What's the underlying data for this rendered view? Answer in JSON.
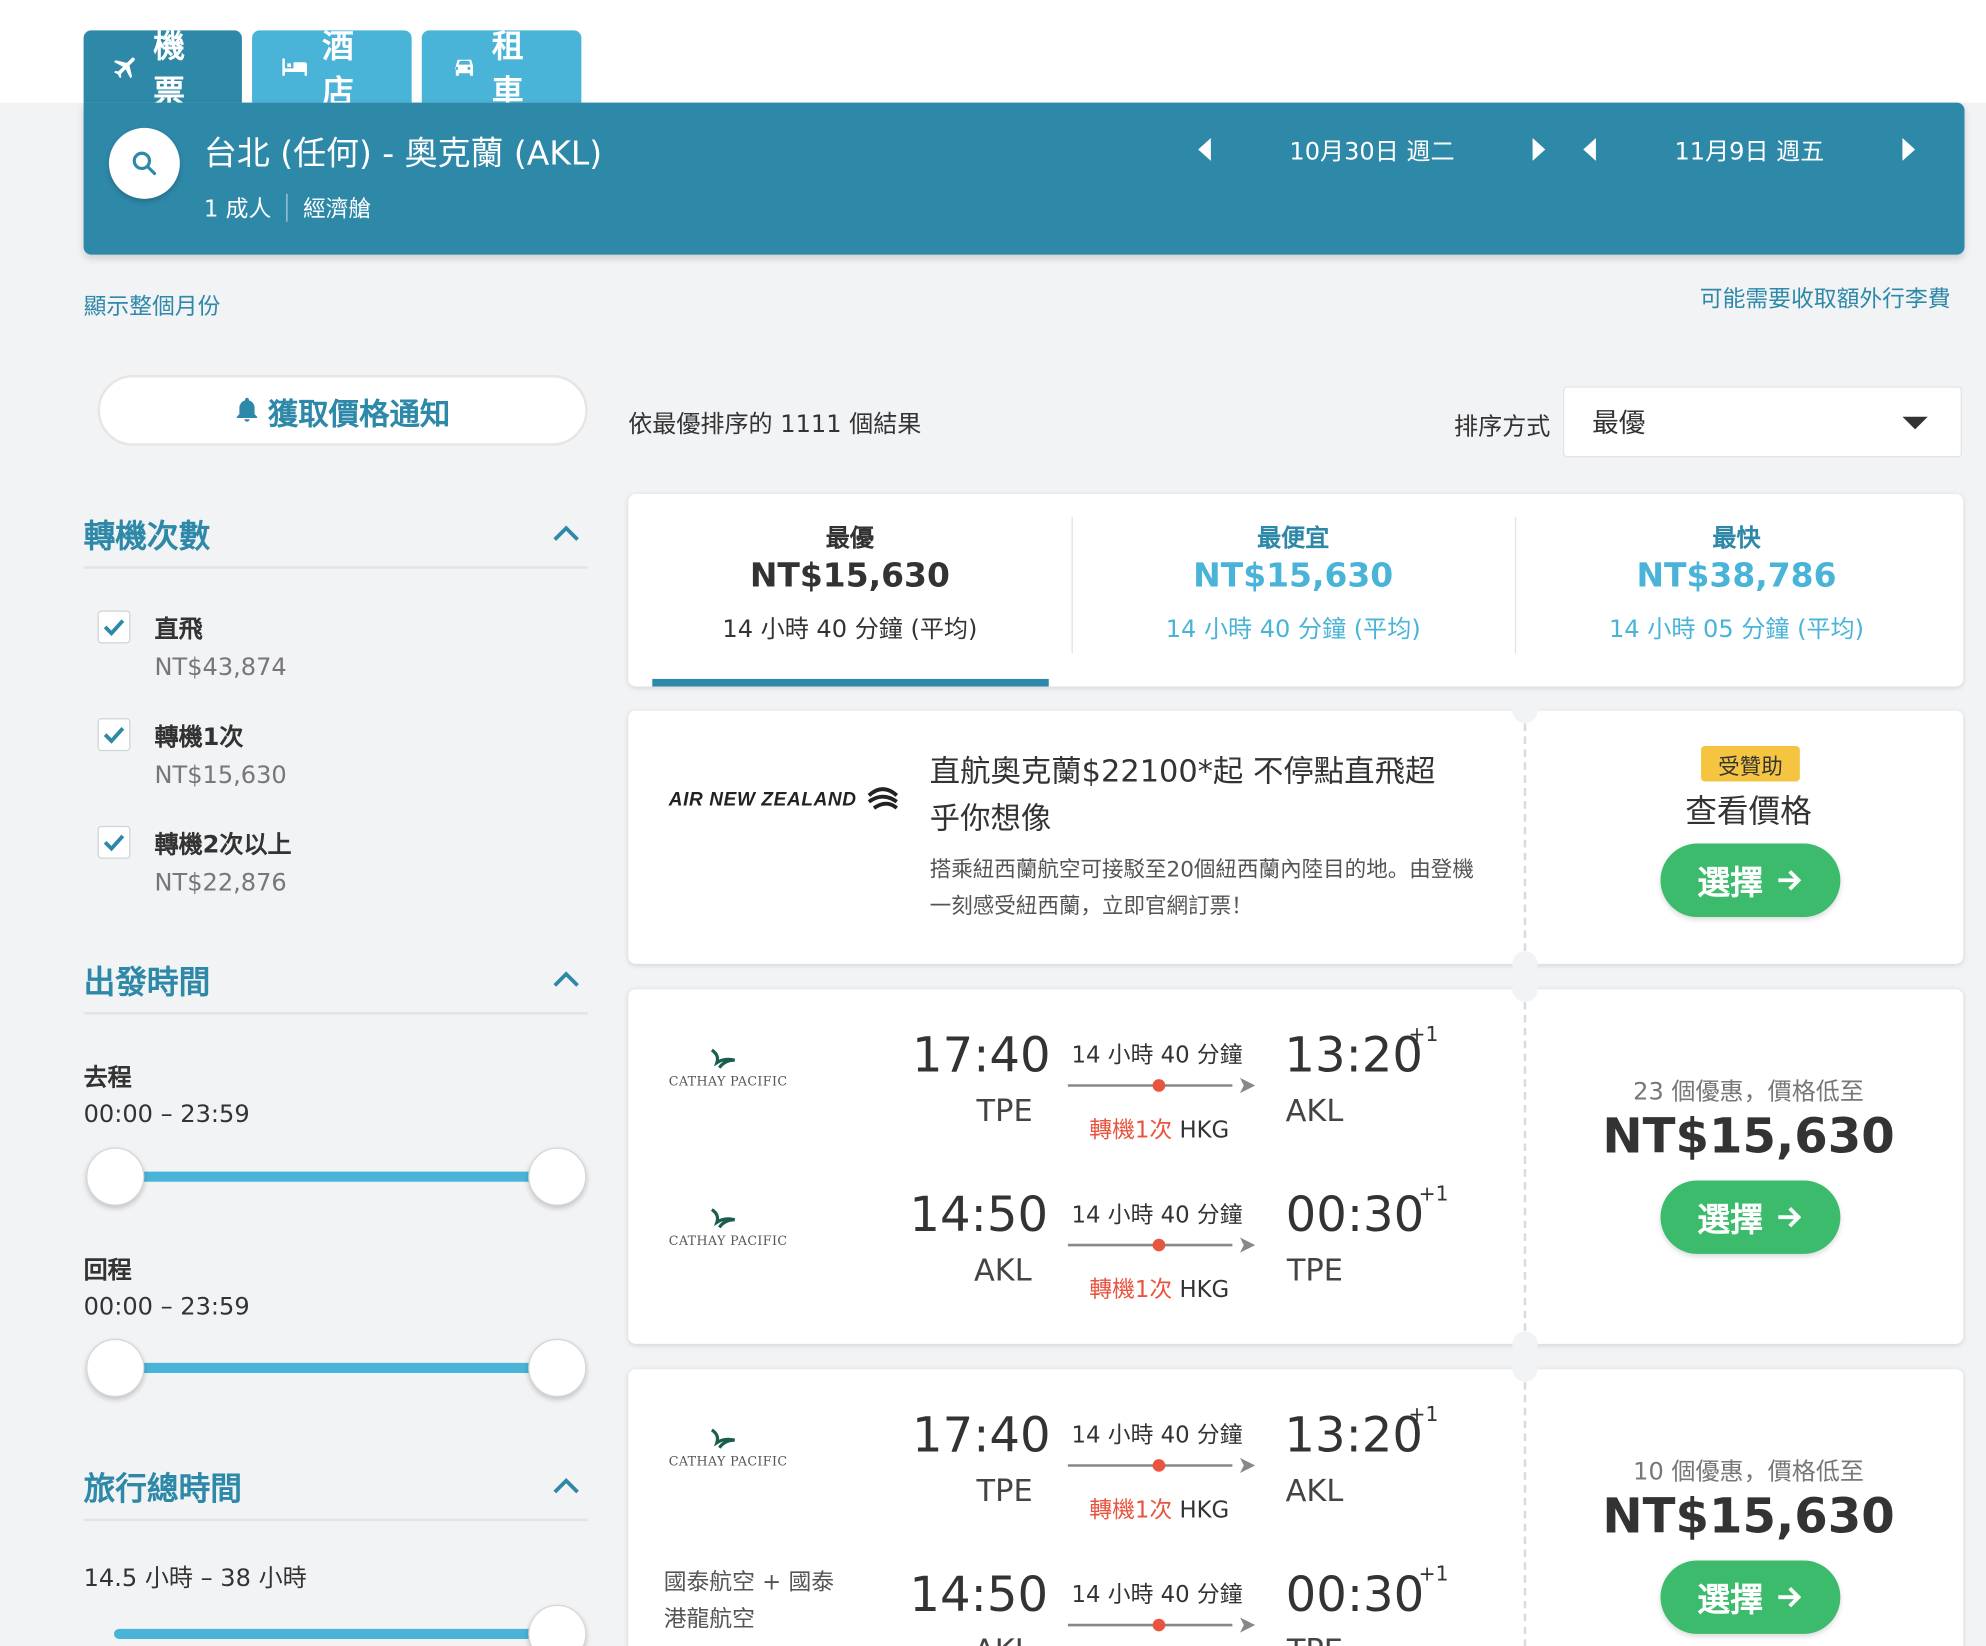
{
  "tabs": [
    {
      "label": "機票",
      "icon": "plane-icon",
      "active": true
    },
    {
      "label": "酒店",
      "icon": "bed-icon",
      "active": false
    },
    {
      "label": "租車",
      "icon": "car-icon",
      "active": false
    }
  ],
  "search": {
    "route": "台北 (任何) - 奧克蘭 (AKL)",
    "passengers": "1 成人",
    "cabin": "經濟艙",
    "depart_date": "10月30日 週二",
    "return_date": "11月9日 週五"
  },
  "links": {
    "show_month": "顯示整個月份",
    "baggage_fee": "可能需要收取額外行李費"
  },
  "notify_label": "獲取價格通知",
  "filters": {
    "stops_title": "轉機次數",
    "stops": [
      {
        "label": "直飛",
        "price": "NT$43,874",
        "checked": true
      },
      {
        "label": "轉機1次",
        "price": "NT$15,630",
        "checked": true
      },
      {
        "label": "轉機2次以上",
        "price": "NT$22,876",
        "checked": true
      }
    ],
    "departure_title": "出發時間",
    "outbound_label": "去程",
    "outbound_range": "00:00 – 23:59",
    "inbound_label": "回程",
    "inbound_range": "00:00 – 23:59",
    "duration_title": "旅行總時間",
    "duration_range": "14.5 小時 – 38 小時"
  },
  "results": {
    "count_text": "依最優排序的 1111 個結果",
    "sort_label": "排序方式",
    "sort_value": "最優"
  },
  "summary": [
    {
      "title": "最優",
      "price": "NT$15,630",
      "duration": "14 小時 40 分鐘 (平均)",
      "active": true
    },
    {
      "title": "最便宜",
      "price": "NT$15,630",
      "duration": "14 小時 40 分鐘 (平均)",
      "active": false
    },
    {
      "title": "最快",
      "price": "NT$38,786",
      "duration": "14 小時 05 分鐘 (平均)",
      "active": false
    }
  ],
  "ad": {
    "logo_text": "AIR NEW ZEALAND",
    "headline": "直航奧克蘭$22100*起 不停點直飛超乎你想像",
    "body": "搭乘紐西蘭航空可接駁至20個紐西蘭內陸目的地。由登機一刻感受紐西蘭，立即官網訂票！",
    "badge": "受贊助",
    "cta_text": "查看價格",
    "button": "選擇"
  },
  "flights": [
    {
      "legs": [
        {
          "airline": "CATHAY PACIFIC",
          "dep_time": "17:40",
          "dep_code": "TPE",
          "duration": "14 小時 40 分鐘",
          "stop_label": "轉機1次",
          "stop_airport": "HKG",
          "arr_time": "13:20",
          "arr_plus": "+1",
          "arr_code": "AKL"
        },
        {
          "airline": "CATHAY PACIFIC",
          "dep_time": "14:50",
          "dep_code": "AKL",
          "duration": "14 小時 40 分鐘",
          "stop_label": "轉機1次",
          "stop_airport": "HKG",
          "arr_time": "00:30",
          "arr_plus": "+1",
          "arr_code": "TPE"
        }
      ],
      "deals": "23 個優惠，價格低至",
      "price": "NT$15,630",
      "button": "選擇"
    },
    {
      "legs": [
        {
          "airline": "CATHAY PACIFIC",
          "dep_time": "17:40",
          "dep_code": "TPE",
          "duration": "14 小時 40 分鐘",
          "stop_label": "轉機1次",
          "stop_airport": "HKG",
          "arr_time": "13:20",
          "arr_plus": "+1",
          "arr_code": "AKL"
        },
        {
          "airline": "國泰航空 + 國泰港龍航空",
          "dep_time": "14:50",
          "dep_code": "AKL",
          "duration": "14 小時 40 分鐘",
          "stop_label": "",
          "stop_airport": "",
          "arr_time": "00:30",
          "arr_plus": "+1",
          "arr_code": "TPE"
        }
      ],
      "deals": "10 個優惠，價格低至",
      "price": "NT$15,630",
      "button": "選擇"
    }
  ],
  "colors": {
    "primary": "#2e88a8",
    "light_blue": "#4ab3d8",
    "green": "#3cbb6d",
    "stop_red": "#e8543f",
    "sponsor_badge": "#f5c542"
  }
}
